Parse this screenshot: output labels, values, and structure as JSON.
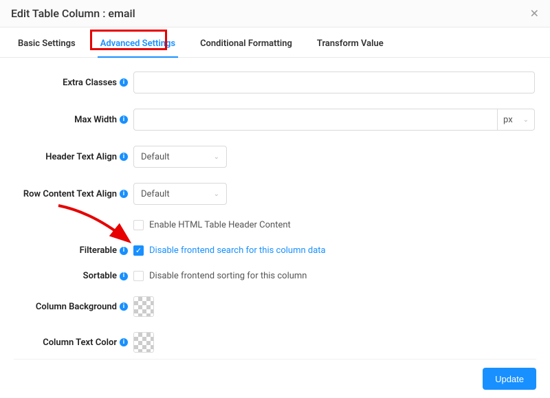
{
  "dialog": {
    "title": "Edit Table Column : email"
  },
  "tabs": {
    "basic": "Basic Settings",
    "advanced": "Advanced Settings",
    "conditional": "Conditional Formatting",
    "transform": "Transform Value"
  },
  "labels": {
    "extra_classes": "Extra Classes",
    "max_width": "Max Width",
    "header_text_align": "Header Text Align",
    "row_content_text_align": "Row Content Text Align",
    "filterable": "Filterable",
    "sortable": "Sortable",
    "column_background": "Column Background",
    "column_text_color": "Column Text Color"
  },
  "values": {
    "extra_classes": "",
    "max_width": "",
    "unit": "px",
    "header_align": "Default",
    "row_align": "Default"
  },
  "checkboxes": {
    "enable_html_header": "Enable HTML Table Header Content",
    "filterable": "Disable frontend search for this column data",
    "sortable": "Disable frontend sorting for this column"
  },
  "footer": {
    "update": "Update"
  }
}
